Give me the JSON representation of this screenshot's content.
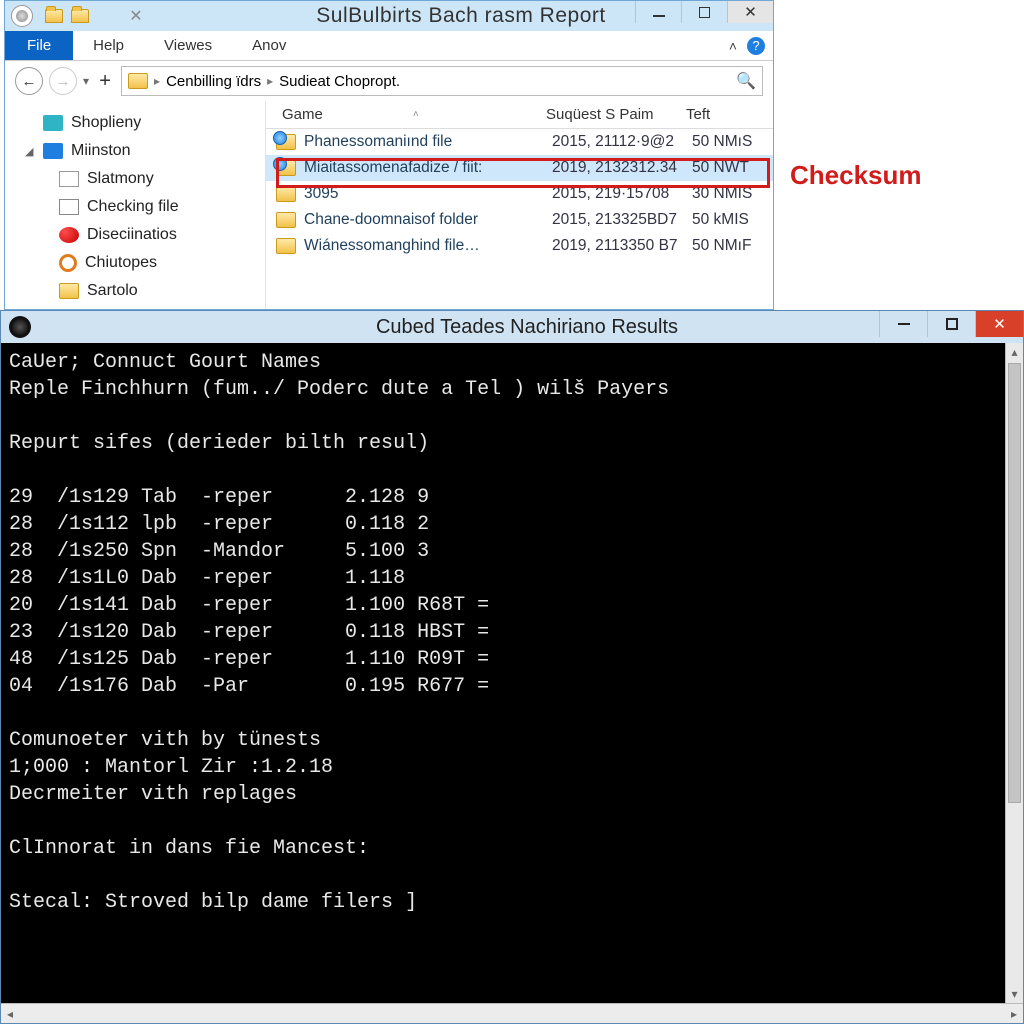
{
  "explorer": {
    "title": "SulBulbirts Bach rasm Report",
    "menu": {
      "file": "File",
      "help": "Help",
      "views": "Viewes",
      "anov": "Anov"
    },
    "breadcrumb": {
      "seg1": "Cenbilling ïdrs",
      "seg2": "Sudieat Chopropt."
    },
    "tree": {
      "n0": "Shoplieny",
      "n1": "Miinston",
      "n2": "Slatmony",
      "n3": "Checking file",
      "n4": "Diseciinatios",
      "n5": "Chiutopes",
      "n6": "Sartolo"
    },
    "cols": {
      "c1": "Game",
      "c2": "Suqüest S Paim",
      "c3": "Teft"
    },
    "rows": [
      {
        "name": "Phanessomaniınd file",
        "date": "2015, 21112·9@2",
        "size": "50 NMıS"
      },
      {
        "name": "Miaitassomenafadize / fiit:",
        "date": "2019, 2132312.34",
        "size": "50 NWT"
      },
      {
        "name": "3095",
        "date": "2015, 219·15708",
        "size": "30 NMIS"
      },
      {
        "name": "Chane-doomnaisof folder",
        "date": "2015, 213325BD7",
        "size": "50 kMIS"
      },
      {
        "name": "Wiánessomanghind file…",
        "date": "2019, 2113350 B7",
        "size": "50 NMıF"
      }
    ]
  },
  "callout": "Checksum",
  "console": {
    "title": "Cubed Teades Nachiriano Results",
    "lines": [
      "CaUer; Connuct Gourt Names",
      "Reple Finchhurn (fum../ Poderc dute a Tel ) wilš Payers",
      "",
      "Repurt sifes (derieder bilth resul)",
      "",
      "29  /1s129 Tab  -reper      2.128 9",
      "28  /1s112 lpb  -reper      0.118 2",
      "28  /1s250 Spn  -Mandor     5.100 3",
      "28  /1s1L0 Dab  -reper      1.118",
      "20  /1s141 Dab  -reper      1.100 R68T =",
      "23  /1s120 Dab  -reper      0.118 HBST =",
      "48  /1s125 Dab  -reper      1.110 R09T =",
      "04  /1s176 Dab  -Par        0.195 R677 =",
      "",
      "Comunoeter vith by tünests",
      "1;000 : Mantorl Zir :1.2.18",
      "Decrmeiter vith replages",
      "",
      "ClInnorat in dans fie Mancest:",
      "",
      "Stecal: Stroved bilp dame filers ]"
    ]
  }
}
